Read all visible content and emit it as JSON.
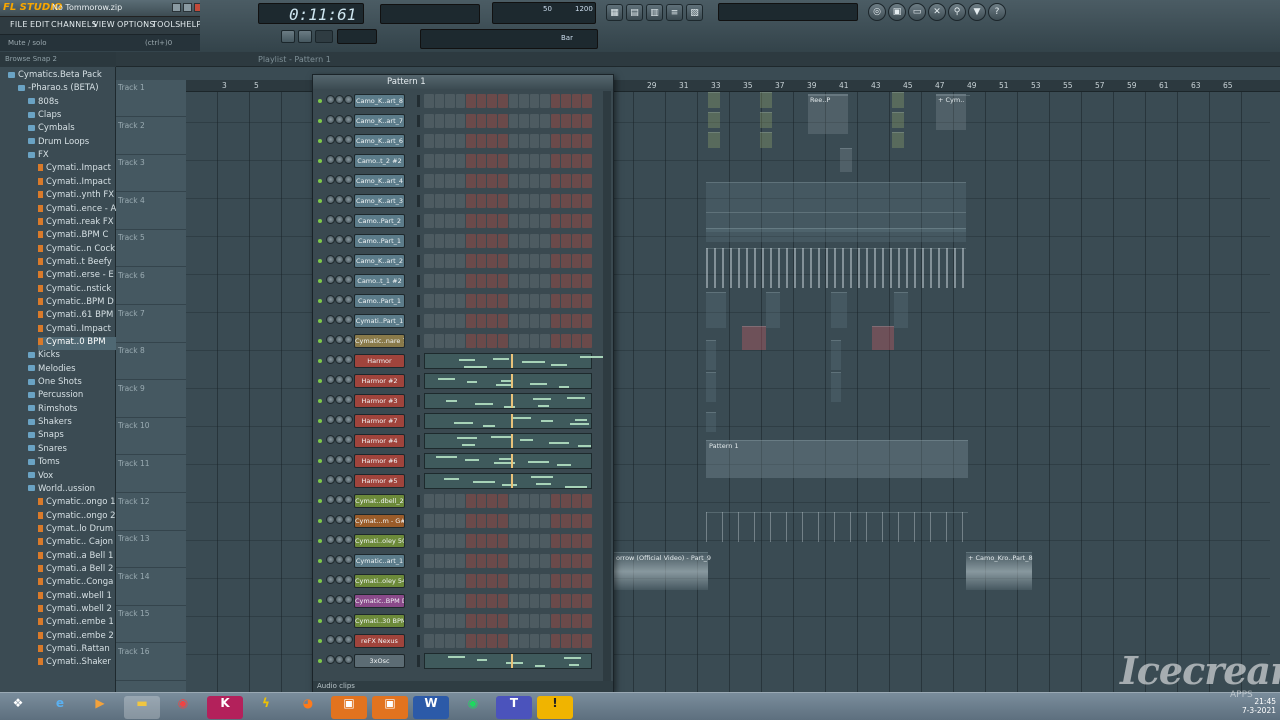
{
  "app": {
    "logo": "FL STUDIO",
    "file": "No Tommorow.zip",
    "hint": "Mute / solo",
    "hint_right": "(ctrl+)0"
  },
  "menu": [
    "FILE",
    "EDIT",
    "CHANNELS",
    "VIEW",
    "OPTIONS",
    "TOOLS",
    "HELP"
  ],
  "transport": {
    "time": "0:11:61",
    "tempo_label": "Bar",
    "meter_a": "50",
    "meter_b": "1200"
  },
  "browser": {
    "header": "Browse  Snap 2",
    "items": [
      {
        "label": "Cymatics.Beta Pack",
        "type": "folder",
        "indent": 0
      },
      {
        "label": "-Pharao.s (BETA)",
        "type": "folder",
        "indent": 1
      },
      {
        "label": "808s",
        "type": "folder",
        "indent": 2
      },
      {
        "label": "Claps",
        "type": "folder",
        "indent": 2
      },
      {
        "label": "Cymbals",
        "type": "folder",
        "indent": 2
      },
      {
        "label": "Drum Loops",
        "type": "folder",
        "indent": 2
      },
      {
        "label": "FX",
        "type": "folder",
        "indent": 2
      },
      {
        "label": "Cymati..Impact",
        "type": "file",
        "indent": 3
      },
      {
        "label": "Cymati..Impact",
        "type": "file",
        "indent": 3
      },
      {
        "label": "Cymati..ynth FX",
        "type": "file",
        "indent": 3
      },
      {
        "label": "Cymati..ence - A",
        "type": "file",
        "indent": 3
      },
      {
        "label": "Cymati..reak FX",
        "type": "file",
        "indent": 3
      },
      {
        "label": "Cymati..BPM C",
        "type": "file",
        "indent": 3
      },
      {
        "label": "Cymatic..n Cock",
        "type": "file",
        "indent": 3
      },
      {
        "label": "Cymati..t Beefy",
        "type": "file",
        "indent": 3
      },
      {
        "label": "Cymati..erse - E",
        "type": "file",
        "indent": 3
      },
      {
        "label": "Cymatic..nstick",
        "type": "file",
        "indent": 3
      },
      {
        "label": "Cymatic..BPM D",
        "type": "file",
        "indent": 3
      },
      {
        "label": "Cymati..61 BPM",
        "type": "file",
        "indent": 3
      },
      {
        "label": "Cymati..Impact",
        "type": "file",
        "indent": 3
      },
      {
        "label": "Cymat..0 BPM",
        "type": "file",
        "indent": 3,
        "selected": true
      },
      {
        "label": "Kicks",
        "type": "folder",
        "indent": 2
      },
      {
        "label": "Melodies",
        "type": "folder",
        "indent": 2
      },
      {
        "label": "One Shots",
        "type": "folder",
        "indent": 2
      },
      {
        "label": "Percussion",
        "type": "folder",
        "indent": 2
      },
      {
        "label": "Rimshots",
        "type": "folder",
        "indent": 2
      },
      {
        "label": "Shakers",
        "type": "folder",
        "indent": 2
      },
      {
        "label": "Snaps",
        "type": "folder",
        "indent": 2
      },
      {
        "label": "Snares",
        "type": "folder",
        "indent": 2
      },
      {
        "label": "Toms",
        "type": "folder",
        "indent": 2
      },
      {
        "label": "Vox",
        "type": "folder",
        "indent": 2
      },
      {
        "label": "World..ussion",
        "type": "folder",
        "indent": 2
      },
      {
        "label": "Cymatic..ongo 1",
        "type": "file",
        "indent": 3
      },
      {
        "label": "Cymatic..ongo 2",
        "type": "file",
        "indent": 3
      },
      {
        "label": "Cymat..lo Drum",
        "type": "file",
        "indent": 3
      },
      {
        "label": "Cymatic.. Cajon",
        "type": "file",
        "indent": 3
      },
      {
        "label": "Cymati..a Bell 1",
        "type": "file",
        "indent": 3
      },
      {
        "label": "Cymati..a Bell 2",
        "type": "file",
        "indent": 3
      },
      {
        "label": "Cymatic..Conga",
        "type": "file",
        "indent": 3
      },
      {
        "label": "Cymati..wbell 1",
        "type": "file",
        "indent": 3
      },
      {
        "label": "Cymati..wbell 2",
        "type": "file",
        "indent": 3
      },
      {
        "label": "Cymati..embe 1",
        "type": "file",
        "indent": 3
      },
      {
        "label": "Cymati..embe 2",
        "type": "file",
        "indent": 3
      },
      {
        "label": "Cymati..Rattan",
        "type": "file",
        "indent": 3
      },
      {
        "label": "Cymati..Shaker",
        "type": "file",
        "indent": 3
      }
    ]
  },
  "playlist": {
    "title": "Playlist - Pattern 1",
    "tracks": [
      "Track 1",
      "Track 2",
      "Track 3",
      "Track 4",
      "Track 5",
      "Track 6",
      "Track 7",
      "Track 8",
      "Track 9",
      "Track 10",
      "Track 11",
      "Track 12",
      "Track 13",
      "Track 14",
      "Track 15",
      "Track 16"
    ],
    "ruler": [
      "3",
      "5",
      "29",
      "31",
      "33",
      "35",
      "37",
      "39",
      "41",
      "43",
      "45",
      "47",
      "49",
      "51",
      "53",
      "55",
      "57",
      "59",
      "61",
      "63",
      "65"
    ],
    "clip_labels": {
      "ree": "Ree..P",
      "cym": "+ Cym..",
      "pattern1": "Pattern 1",
      "video": "orrow (Official Video) - Part_9",
      "camo": "+ Camo_Kro..Part_8"
    }
  },
  "channel_rack": {
    "title": "Pattern 1",
    "footer": "Audio clips",
    "channels": [
      {
        "name": "Camo_K..art_8",
        "color": "#5c7c8a",
        "mode": "steps"
      },
      {
        "name": "Camo_K..art_7",
        "color": "#5c7c8a",
        "mode": "steps"
      },
      {
        "name": "Camo_K..art_6",
        "color": "#5c7c8a",
        "mode": "steps"
      },
      {
        "name": "Camo..t_2 #2",
        "color": "#5c7c8a",
        "mode": "steps"
      },
      {
        "name": "Camo_K..art_4",
        "color": "#5c7c8a",
        "mode": "steps"
      },
      {
        "name": "Camo_K..art_3",
        "color": "#5c7c8a",
        "mode": "steps"
      },
      {
        "name": "Camo..Part_2",
        "color": "#5c7c8a",
        "mode": "steps"
      },
      {
        "name": "Camo..Part_1",
        "color": "#5c7c8a",
        "mode": "steps"
      },
      {
        "name": "Camo_K..art_2",
        "color": "#5c7c8a",
        "mode": "steps"
      },
      {
        "name": "Camo..t_1 #2",
        "color": "#5c7c8a",
        "mode": "steps"
      },
      {
        "name": "Camo..Part_1",
        "color": "#5c7c8a",
        "mode": "steps"
      },
      {
        "name": "Cymati..Part_1",
        "color": "#5c7c8a",
        "mode": "steps"
      },
      {
        "name": "Cymatic..nare 7",
        "color": "#8a7a4a",
        "mode": "steps"
      },
      {
        "name": "Harmor",
        "color": "#a0443c",
        "mode": "piano"
      },
      {
        "name": "Harmor #2",
        "color": "#a0443c",
        "mode": "piano"
      },
      {
        "name": "Harmor #3",
        "color": "#a0443c",
        "mode": "piano"
      },
      {
        "name": "Harmor #7",
        "color": "#a0443c",
        "mode": "piano"
      },
      {
        "name": "Harmor #4",
        "color": "#a0443c",
        "mode": "piano"
      },
      {
        "name": "Harmor #6",
        "color": "#a0443c",
        "mode": "piano"
      },
      {
        "name": "Harmor #5",
        "color": "#a0443c",
        "mode": "piano"
      },
      {
        "name": "Cymat..dbell_2",
        "color": "#6c8a3a",
        "mode": "steps"
      },
      {
        "name": "Cymat...m - G#",
        "color": "#9a5c2a",
        "mode": "steps"
      },
      {
        "name": "Cymati..oley 50",
        "color": "#6c8a3a",
        "mode": "steps"
      },
      {
        "name": "Cymatic..art_1",
        "color": "#5c7c8a",
        "mode": "steps"
      },
      {
        "name": "Cymati..oley 54",
        "color": "#6c8a3a",
        "mode": "steps"
      },
      {
        "name": "Cymatic..BPM D",
        "color": "#8a4a8a",
        "mode": "steps"
      },
      {
        "name": "Cymati..30 BPM",
        "color": "#6c8a3a",
        "mode": "steps"
      },
      {
        "name": "reFX Nexus",
        "color": "#a0443c",
        "mode": "steps"
      },
      {
        "name": "3xOsc",
        "color": "#5c6c74",
        "mode": "piano"
      }
    ]
  },
  "taskbar": {
    "apps": [
      "start",
      "ie",
      "media",
      "chrome",
      "k",
      "winamp",
      "firefox",
      "box1",
      "box2",
      "word",
      "spotify",
      "teams",
      "alert"
    ],
    "time": "21:45",
    "date": "7-3-2021"
  },
  "watermark": {
    "text": "Icecream",
    "sub": "APPS"
  }
}
